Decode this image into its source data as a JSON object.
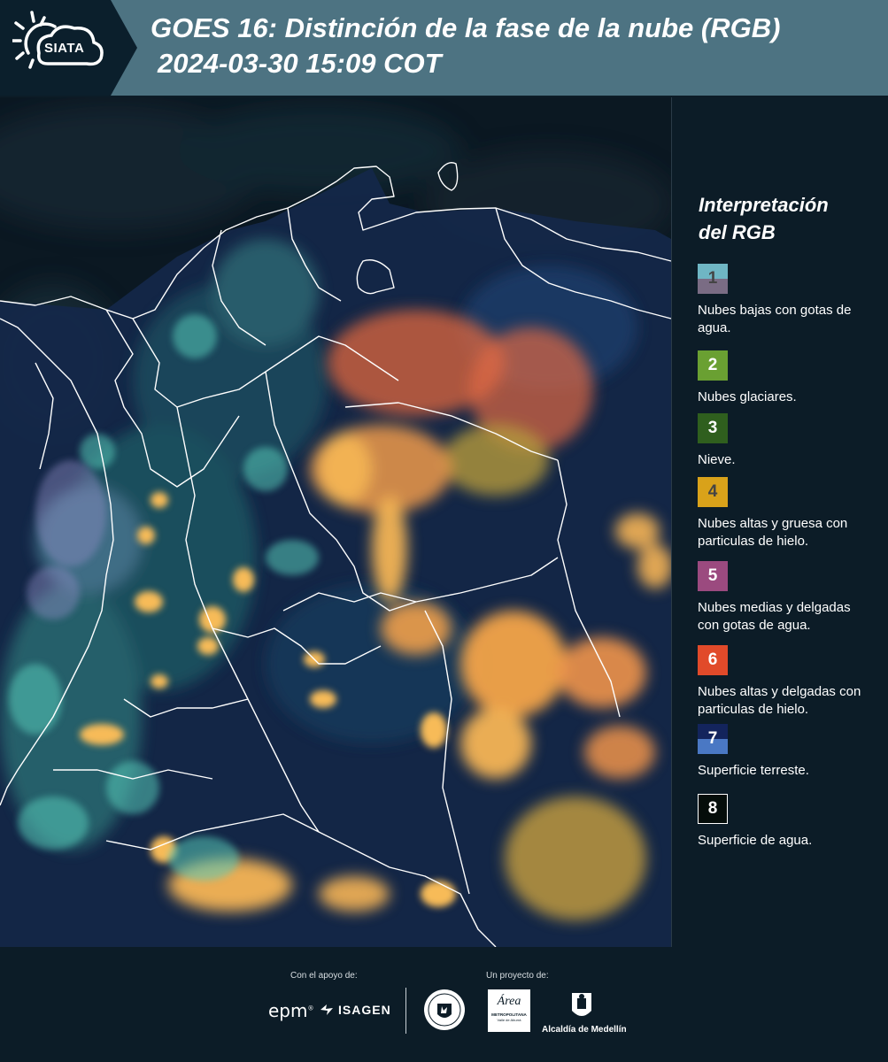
{
  "header": {
    "logo_text": "SIATA",
    "title_line1": "GOES 16: Distinción de la fase de la nube (RGB)",
    "title_line2": "2024-03-30 15:09 COT"
  },
  "legend": {
    "title_line1": "Interpretación",
    "title_line2": "del RGB",
    "items": [
      {
        "num": "1",
        "label": "Nubes bajas con gotas de agua.",
        "color_top": "#6fb6c4",
        "color_bottom": "#7a6c84",
        "num_color": "#444444"
      },
      {
        "num": "2",
        "label": "Nubes glaciares.",
        "color_top": "#6aa032",
        "color_bottom": "#6aa032",
        "num_color": "#ffffff"
      },
      {
        "num": "3",
        "label": "Nieve.",
        "color_top": "#2f5f1e",
        "color_bottom": "#2f5f1e",
        "num_color": "#ffffff"
      },
      {
        "num": "4",
        "label": "Nubes altas y gruesa con particulas de hielo.",
        "color_top": "#d9a21a",
        "color_bottom": "#d9a21a",
        "num_color": "#444444"
      },
      {
        "num": "5",
        "label": "Nubes medias y delgadas con gotas de agua.",
        "color_top": "#9b4a7f",
        "color_bottom": "#9b4a7f",
        "num_color": "#ffffff"
      },
      {
        "num": "6",
        "label": "Nubes altas y delgadas con particulas de hielo.",
        "color_top": "#e14a2a",
        "color_bottom": "#e14a2a",
        "num_color": "#ffffff"
      },
      {
        "num": "7",
        "label": "Superficie terreste.",
        "color_top": "#13245c",
        "color_bottom": "#4a78c4",
        "num_color": "#ffffff"
      },
      {
        "num": "8",
        "label": "Superficie de agua.",
        "color_top": "#050d0a",
        "color_bottom": "#050d0a",
        "num_color": "#ffffff"
      }
    ]
  },
  "footer": {
    "support_label": "Con el apoyo de:",
    "project_label": "Un proyecto de:",
    "epm": "epm",
    "isagen": "ISAGEN",
    "area_main": "Área",
    "area_sub": "METROPOLITANA",
    "area_sub2": "Valle de Aburrá",
    "alcaldia": "Alcaldía de Medellín"
  }
}
